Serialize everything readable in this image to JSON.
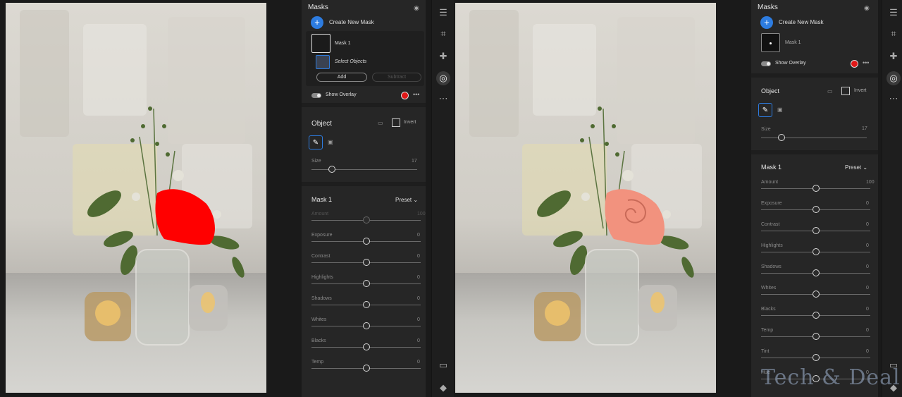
{
  "left_panel": {
    "masks_title": "Masks",
    "create_new_mask": "Create New Mask",
    "mask_item": "Mask 1",
    "select_objects": "Select Objects",
    "add_label": "Add",
    "subtract_label": "Subtract",
    "show_overlay": "Show Overlay",
    "object_title": "Object",
    "invert_label": "Invert",
    "size_label": "Size",
    "size_value": "17",
    "mask_title": "Mask 1",
    "preset_label": "Preset",
    "sliders": [
      {
        "label": "Amount",
        "value": "100"
      },
      {
        "label": "Exposure",
        "value": "0"
      },
      {
        "label": "Contrast",
        "value": "0"
      },
      {
        "label": "Highlights",
        "value": "0"
      },
      {
        "label": "Shadows",
        "value": "0"
      },
      {
        "label": "Whites",
        "value": "0"
      },
      {
        "label": "Blacks",
        "value": "0"
      },
      {
        "label": "Temp",
        "value": "0"
      }
    ]
  },
  "right_panel": {
    "masks_title": "Masks",
    "create_new_mask": "Create New Mask",
    "mask_item": "Mask 1",
    "show_overlay": "Show Overlay",
    "object_title": "Object",
    "invert_label": "Invert",
    "size_label": "Size",
    "size_value": "17",
    "mask_title": "Mask 1",
    "preset_label": "Preset",
    "sliders": [
      {
        "label": "Amount",
        "value": "100"
      },
      {
        "label": "Exposure",
        "value": "0"
      },
      {
        "label": "Contrast",
        "value": "0"
      },
      {
        "label": "Highlights",
        "value": "0"
      },
      {
        "label": "Shadows",
        "value": "0"
      },
      {
        "label": "Whites",
        "value": "0"
      },
      {
        "label": "Blacks",
        "value": "0"
      },
      {
        "label": "Temp",
        "value": "0"
      },
      {
        "label": "Tint",
        "value": "0"
      },
      {
        "label": "Hue",
        "value": "0"
      }
    ]
  },
  "watermark": "Tech & Deal",
  "colors": {
    "accent": "#2d7ce0",
    "overlay_red": "#ff0000",
    "rose": "#f2927e"
  },
  "icons": [
    "eye-icon",
    "plus-icon",
    "sliders-icon",
    "crop-icon",
    "bandage-icon",
    "mask-icon",
    "more-icon",
    "comment-icon",
    "tag-icon",
    "brush-icon",
    "invert-icon",
    "chevron-down-icon"
  ]
}
